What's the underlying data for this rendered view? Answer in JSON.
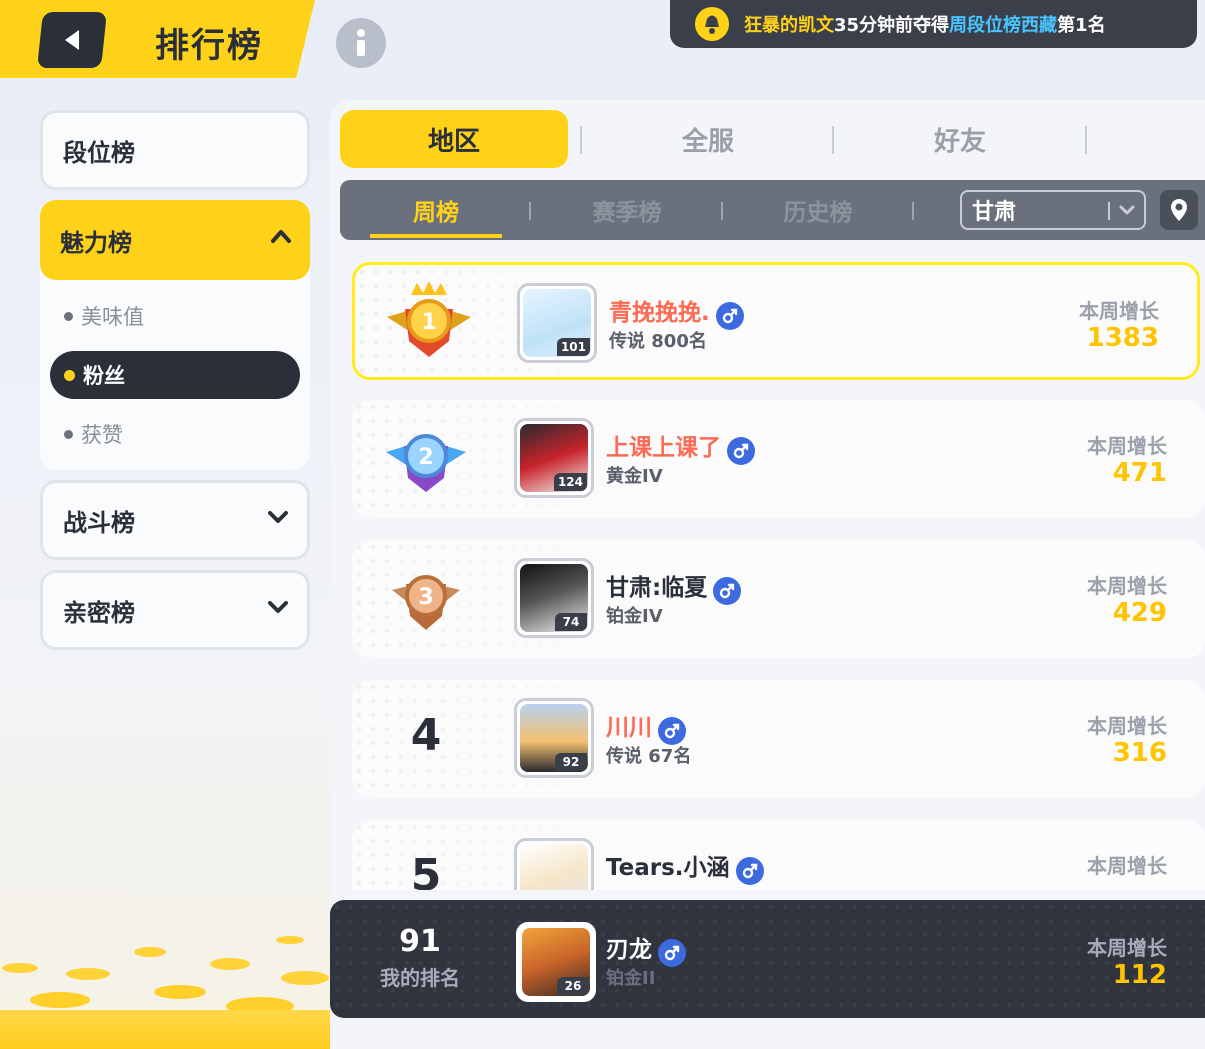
{
  "header": {
    "title": "排行榜"
  },
  "notice": {
    "player": "狂暴的凯文",
    "time_text": "35分钟前夺得",
    "board": "周段位榜西藏",
    "rank_text": "第1名"
  },
  "sidebar": {
    "items": [
      {
        "label": "段位榜"
      },
      {
        "label": "魅力榜",
        "expanded": true,
        "sub": [
          {
            "label": "美味值"
          },
          {
            "label": "粉丝",
            "active": true
          },
          {
            "label": "获赞"
          }
        ]
      },
      {
        "label": "战斗榜"
      },
      {
        "label": "亲密榜"
      }
    ]
  },
  "tabs": [
    {
      "label": "地区",
      "active": true
    },
    {
      "label": "全服"
    },
    {
      "label": "好友"
    }
  ],
  "subtabs": [
    {
      "label": "周榜",
      "active": true
    },
    {
      "label": "赛季榜"
    },
    {
      "label": "历史榜"
    }
  ],
  "region": {
    "value": "甘肃"
  },
  "rows": [
    {
      "rank": "1",
      "level": "101",
      "name": "青挽挽挽.",
      "gender": "male",
      "tier": "传说 800名",
      "growth_label": "本周增长",
      "growth": "1383",
      "name_color": "red"
    },
    {
      "rank": "2",
      "level": "124",
      "name": "上课上课了",
      "gender": "male",
      "tier": "黄金IV",
      "growth_label": "本周增长",
      "growth": "471",
      "name_color": "red"
    },
    {
      "rank": "3",
      "level": "74",
      "name": "甘肃:临夏",
      "gender": "male",
      "tier": "铂金IV",
      "growth_label": "本周增长",
      "growth": "429",
      "name_color": "dark"
    },
    {
      "rank": "4",
      "level": "92",
      "name": "川川",
      "gender": "male",
      "tier": "传说 67名",
      "growth_label": "本周增长",
      "growth": "316",
      "name_color": "red"
    },
    {
      "rank": "5",
      "level": "",
      "name": "Tears.小涵",
      "gender": "male",
      "tier": "",
      "growth_label": "本周增长",
      "growth": "",
      "name_color": "dark"
    }
  ],
  "my_rank": {
    "rank": "91",
    "label": "我的排名",
    "level": "26",
    "name": "刃龙",
    "tier": "铂金II",
    "growth_label": "本周增长",
    "growth": "112"
  },
  "colors": {
    "accent": "#ffd21a",
    "dark": "#2a2f3a",
    "growth": "#ffc400",
    "name_red": "#ff6a52",
    "gender_blue": "#3e6ae0",
    "notice_blue": "#49c6ff"
  }
}
